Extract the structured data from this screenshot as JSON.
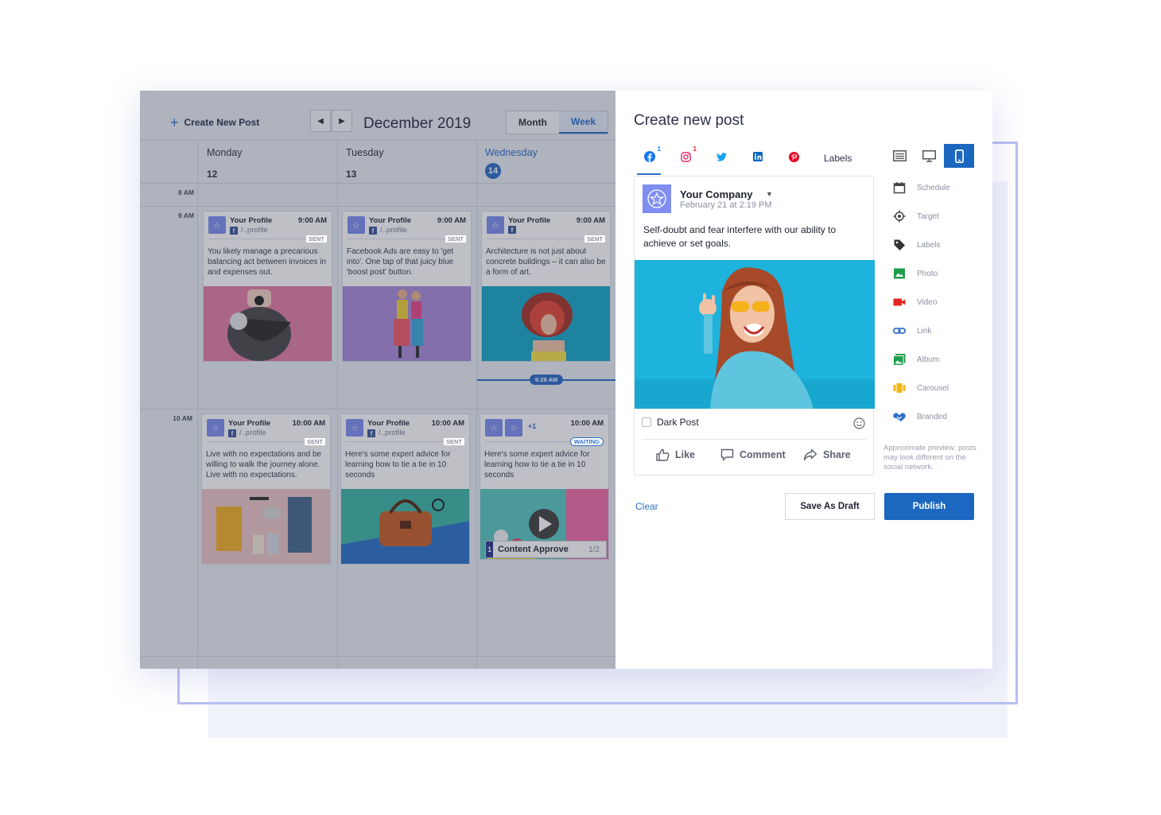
{
  "calendar": {
    "create_label": "Create New Post",
    "title": "December 2019",
    "views": [
      "Month",
      "Week"
    ],
    "active_view": "Week",
    "days": [
      {
        "name": "Monday",
        "num": "12"
      },
      {
        "name": "Tuesday",
        "num": "13"
      },
      {
        "name": "Wednesday",
        "num": "14"
      }
    ],
    "times": [
      "8 AM",
      "9 AM",
      "10 AM"
    ],
    "now_label": "9:28 AM",
    "posts": [
      {
        "profile": "Your Profile",
        "handle": "/..profile",
        "time": "9:00 AM",
        "status": "SENT",
        "text": "You likely manage a precarious balancing act between invoices in and expenses out."
      },
      {
        "profile": "Your Profile",
        "handle": "/..profile",
        "time": "9:00 AM",
        "status": "SENT",
        "text": "Facebook Ads are easy to 'get into'. One tap of that juicy blue 'boost post' button."
      },
      {
        "profile": "Your Profile",
        "handle": "",
        "time": "9:00 AM",
        "status": "SENT",
        "text": "Architecture is not just about concrete buildings – it can also be a form of art."
      },
      {
        "profile": "Your Profile",
        "handle": "/..profile",
        "time": "10:00 AM",
        "status": "SENT",
        "text": "Live with no expectations and be willing to walk the journey alone. Live with no expectations."
      },
      {
        "profile": "Your Profile",
        "handle": "/..profile",
        "time": "10:00 AM",
        "status": "SENT",
        "text": "Here's some expert advice for learning how to tie a tie in 10 seconds"
      },
      {
        "profile": "",
        "handle": "",
        "extra": "+1",
        "time": "10:00 AM",
        "status": "WAITING",
        "text": "Here's some expert advice for learning how to tie a tie in 10 seconds"
      }
    ],
    "approval": {
      "step": "1",
      "label": "Content Approve",
      "progress": "1/2"
    }
  },
  "panel": {
    "title": "Create new post",
    "networks": [
      {
        "name": "facebook-icon",
        "badge": "1",
        "color": "#1877f2"
      },
      {
        "name": "instagram-icon",
        "badge": "1",
        "color": "#e1306c"
      },
      {
        "name": "twitter-icon",
        "badge": "",
        "color": "#1da1f2"
      },
      {
        "name": "linkedin-icon",
        "badge": "",
        "color": "#0a66c2"
      },
      {
        "name": "pinterest-icon",
        "badge": "",
        "color": "#e60023"
      }
    ],
    "labels_tab": "Labels",
    "preview": {
      "company": "Your Company",
      "date": "February 21 at 2:19 PM",
      "text": "Self-doubt and fear interfere with our ability to achieve or set goals.",
      "dark_post": "Dark Post",
      "actions": [
        "Like",
        "Comment",
        "Share"
      ]
    },
    "tools": [
      "Schedule",
      "Target",
      "Labels",
      "Photo",
      "Video",
      "Link",
      "Album",
      "Carousel",
      "Branded"
    ],
    "approx_note": "Approximate preview: posts may look different on the social network.",
    "clear": "Clear",
    "save_draft": "Save As Draft",
    "publish": "Publish"
  },
  "colors": {
    "accent": "#1c67c0",
    "avatar": "#7f8ef0"
  }
}
